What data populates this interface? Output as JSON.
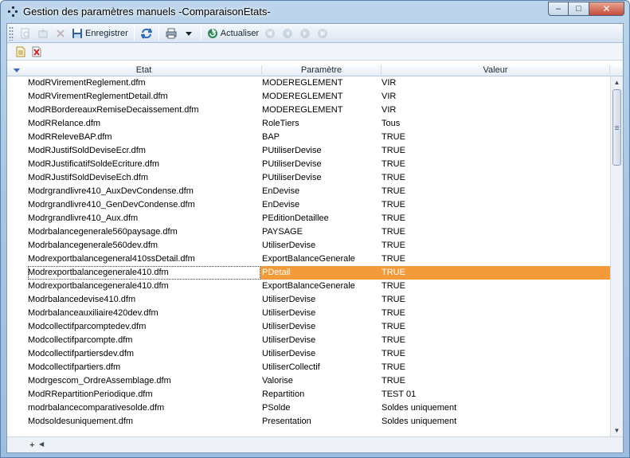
{
  "window": {
    "title": "Gestion des paramètres manuels -ComparaisonEtats-",
    "controls": {
      "minimize": "–",
      "maximize": "□",
      "close": "✕"
    }
  },
  "toolbar": {
    "enregistrer_label": "Enregistrer",
    "actualiser_label": "Actualiser"
  },
  "columns": {
    "etat": "Etat",
    "parametre": "Paramètre",
    "valeur": "Valeur"
  },
  "rows": [
    {
      "etat": "ModRVirementReglement.dfm",
      "parametre": "MODEREGLEMENT",
      "valeur": "VIR"
    },
    {
      "etat": "ModRVirementReglementDetail.dfm",
      "parametre": "MODEREGLEMENT",
      "valeur": "VIR"
    },
    {
      "etat": "ModRBordereauxRemiseDecaissement.dfm",
      "parametre": "MODEREGLEMENT",
      "valeur": "VIR"
    },
    {
      "etat": "ModRRelance.dfm",
      "parametre": "RoleTiers",
      "valeur": "Tous"
    },
    {
      "etat": "ModRReleveBAP.dfm",
      "parametre": "BAP",
      "valeur": "TRUE"
    },
    {
      "etat": "ModRJustifSoldDeviseEcr.dfm",
      "parametre": "PUtiliserDevise",
      "valeur": "TRUE"
    },
    {
      "etat": "ModRJustificatifSoldeEcriture.dfm",
      "parametre": "PUtiliserDevise",
      "valeur": "TRUE"
    },
    {
      "etat": "ModRJustifSoldDeviseEch.dfm",
      "parametre": "PUtiliserDevise",
      "valeur": "TRUE"
    },
    {
      "etat": "Modrgrandlivre410_AuxDevCondense.dfm",
      "parametre": "EnDevise",
      "valeur": "TRUE"
    },
    {
      "etat": "Modrgrandlivre410_GenDevCondense.dfm",
      "parametre": "EnDevise",
      "valeur": "TRUE"
    },
    {
      "etat": "Modrgrandlivre410_Aux.dfm",
      "parametre": "PEditionDetaillee",
      "valeur": "TRUE"
    },
    {
      "etat": "Modrbalancegenerale560paysage.dfm",
      "parametre": "PAYSAGE",
      "valeur": "TRUE"
    },
    {
      "etat": "Modrbalancegenerale560dev.dfm",
      "parametre": "UtiliserDevise",
      "valeur": "TRUE"
    },
    {
      "etat": "Modrexportbalancegeneral410ssDetail.dfm",
      "parametre": "ExportBalanceGenerale",
      "valeur": "TRUE"
    },
    {
      "etat": "Modrexportbalancegenerale410.dfm",
      "parametre": "PDetail",
      "valeur": "TRUE",
      "selected": true
    },
    {
      "etat": "Modrexportbalancegenerale410.dfm",
      "parametre": "ExportBalanceGenerale",
      "valeur": "TRUE"
    },
    {
      "etat": "Modrbalancedevise410.dfm",
      "parametre": "UtiliserDevise",
      "valeur": "TRUE"
    },
    {
      "etat": "Modrbalanceauxiliaire420dev.dfm",
      "parametre": "UtiliserDevise",
      "valeur": "TRUE"
    },
    {
      "etat": "Modcollectifparcomptedev.dfm",
      "parametre": "UtiliserDevise",
      "valeur": "TRUE"
    },
    {
      "etat": "Modcollectifparcompte.dfm",
      "parametre": "UtiliserDevise",
      "valeur": "TRUE"
    },
    {
      "etat": "Modcollectifpartiersdev.dfm",
      "parametre": "UtiliserDevise",
      "valeur": "TRUE"
    },
    {
      "etat": "Modcollectifpartiers.dfm",
      "parametre": "UtiliserCollectif",
      "valeur": "TRUE"
    },
    {
      "etat": "Modrgescom_OrdreAssemblage.dfm",
      "parametre": "Valorise",
      "valeur": "TRUE"
    },
    {
      "etat": "ModRRepartitionPeriodique.dfm",
      "parametre": "Repartition",
      "valeur": "TEST 01"
    },
    {
      "etat": "modrbalancecomparativesolde.dfm",
      "parametre": "PSolde",
      "valeur": "Soldes uniquement"
    },
    {
      "etat": "Modsoldesuniquement.dfm",
      "parametre": "Presentation",
      "valeur": "Soldes uniquement"
    }
  ],
  "footer": {
    "add_label": "+"
  },
  "colors": {
    "selection": "#f39a3a",
    "accent": "#2f6bb7"
  }
}
